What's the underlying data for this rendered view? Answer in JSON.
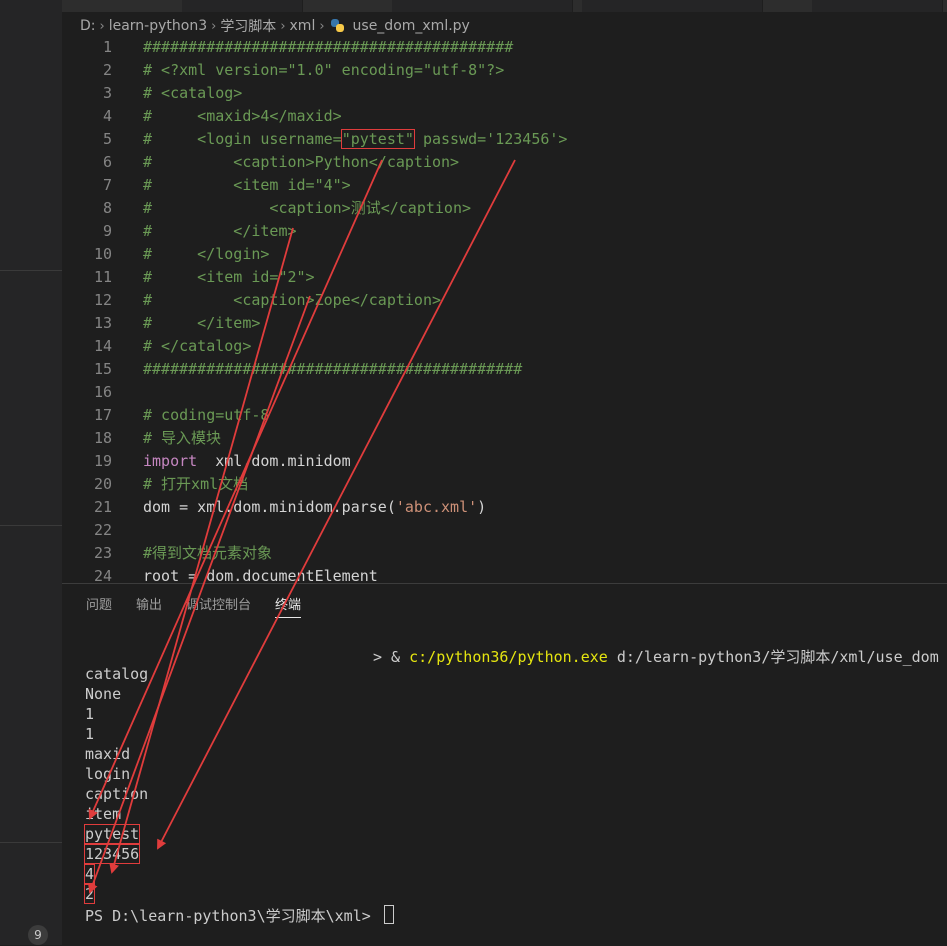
{
  "breadcrumb": {
    "drive": "D:",
    "folder1": "learn-python3",
    "folder2": "学习脚本",
    "folder3": "xml",
    "file": "use_dom_xml.py"
  },
  "code": [
    {
      "n": "1",
      "t": "#########################################"
    },
    {
      "n": "2",
      "t": "# <?xml version=\"1.0\" encoding=\"utf-8\"?>"
    },
    {
      "n": "3",
      "t": "# <catalog>"
    },
    {
      "n": "4",
      "t": "#     <maxid>4</maxid>"
    },
    {
      "n": "5",
      "pre": "#     <login username=",
      "hl": "\"pytest\"",
      "post": " passwd='123456'>"
    },
    {
      "n": "6",
      "t": "#         <caption>Python</caption>"
    },
    {
      "n": "7",
      "t": "#         <item id=\"4\">"
    },
    {
      "n": "8",
      "t": "#             <caption>测试</caption>"
    },
    {
      "n": "9",
      "t": "#         </item>"
    },
    {
      "n": "10",
      "t": "#     </login>"
    },
    {
      "n": "11",
      "t": "#     <item id=\"2\">"
    },
    {
      "n": "12",
      "t": "#         <caption>Zope</caption>"
    },
    {
      "n": "13",
      "t": "#     </item>"
    },
    {
      "n": "14",
      "t": "# </catalog>"
    },
    {
      "n": "15",
      "t": "##########################################"
    },
    {
      "n": "16",
      "t": ""
    },
    {
      "n": "17",
      "t": "# coding=utf-8"
    },
    {
      "n": "18",
      "t": "# 导入模块"
    },
    {
      "n": "19",
      "kw": "import",
      "rest": "  xml.dom.minidom"
    },
    {
      "n": "20",
      "t": "# 打开xml文档"
    },
    {
      "n": "21",
      "pre": "dom = xml.dom.minidom.parse(",
      "str": "'abc.xml'",
      "post": ")"
    },
    {
      "n": "22",
      "t": ""
    },
    {
      "n": "23",
      "t": "#得到文档元素对象"
    },
    {
      "n": "24",
      "t": "root = dom.documentElement"
    }
  ],
  "panel": {
    "tabs": [
      "问题",
      "输出",
      "调试控制台",
      "终端"
    ],
    "active_tab": "终端",
    "command_prefix": "> & ",
    "command_exe": "c:/python36/python.exe",
    "command_arg": " d:/learn-python3/学习脚本/xml/use_dom",
    "output": [
      "catalog",
      "None",
      "1",
      "1",
      "maxid",
      "login",
      "caption",
      "item",
      "pytest",
      "123456",
      "4",
      "2"
    ],
    "prompt": "PS D:\\learn-python3\\学习脚本\\xml> "
  },
  "badge_count": "9",
  "colors": {
    "background": "#1e1e1e",
    "comment": "#6a9955",
    "keyword": "#c586c0",
    "string": "#ce9178",
    "annotation": "#e03c3c",
    "exe": "#e5e510"
  }
}
